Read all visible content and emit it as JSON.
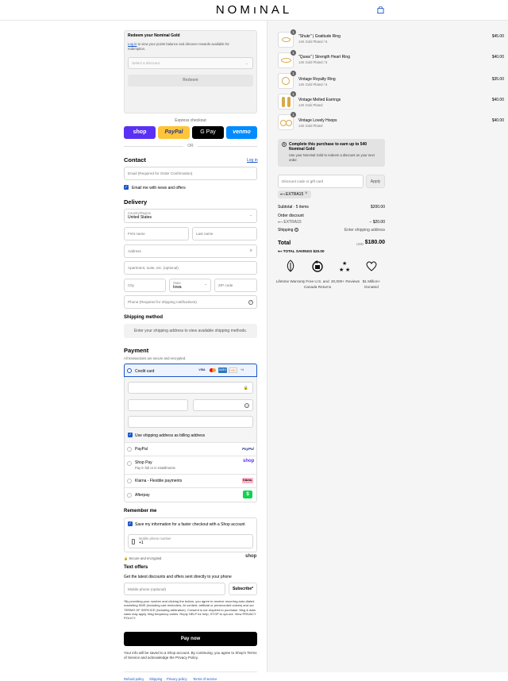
{
  "header": {
    "logo": "NOMıNAL"
  },
  "redeem": {
    "title": "Redeem your Nominal Gold",
    "login_link": "Log in",
    "desc": " to view your points balance and discover rewards available for redemption.",
    "select_placeholder": "Select a discount",
    "button": "Redeem"
  },
  "express": {
    "label": "Express checkout",
    "shop": "shop",
    "paypal": "PayPal",
    "gpay": "G Pay",
    "venmo": "venmo",
    "or": "OR"
  },
  "contact": {
    "title": "Contact",
    "login": "Log in",
    "email_placeholder": "Email (Required for Order Confirmation)",
    "news": "Email me with news and offers"
  },
  "delivery": {
    "title": "Delivery",
    "country_label": "Country/Region",
    "country": "United States",
    "first": "First name",
    "last": "Last name",
    "address": "Address",
    "apt": "Apartment, suite, etc. (optional)",
    "city": "City",
    "state_label": "State",
    "state": "Iowa",
    "zip": "ZIP code",
    "phone": "Phone (Required for shipping notifications)"
  },
  "shipping": {
    "title": "Shipping method",
    "note": "Enter your shipping address to view available shipping methods."
  },
  "payment": {
    "title": "Payment",
    "sub": "All transactions are secure and encrypted.",
    "credit": "Credit card",
    "cards": [
      "VISA",
      "MC",
      "AMEX",
      "DISC",
      "+4"
    ],
    "billing": "Use shipping address as billing address",
    "paypal": "PayPal",
    "paypal_logo": "PayPal",
    "shoppay": "Shop Pay",
    "shoppay_sub": "Pay in full or in installments",
    "shoppay_logo": "shop",
    "klarna": "Klarna - Flexible payments",
    "klarna_logo": "Klarna.",
    "afterpay": "Afterpay",
    "afterpay_logo": "$"
  },
  "remember": {
    "title": "Remember me",
    "save": "Save my information for a faster checkout with a Shop account",
    "mobile_label": "Mobile phone number",
    "mobile_prefix": "+1",
    "secure": "Secure and encrypted",
    "shop_logo": "shop"
  },
  "text_offers": {
    "title": "Text offers",
    "sub": "Get the latest discounts and offers sent directly to your phone",
    "phone_placeholder": "Mobile phone (optional)",
    "subscribe": "Subscribe*",
    "legal": "*By providing your number and clicking the button, you agree to receive recurring auto-dialed marketing SMS (including cart reminders, AI content, artificial or prerecorded voices) and our TERMS OF SERVICE (including arbitration). Consent is not required to purchase. Msg & data rates may apply. Msg frequency varies. Reply HELP for help, STOP to opt-out. View PRIVACY POLICY."
  },
  "pay_button": "Pay now",
  "footer_note": "Your info will be saved to a Shop account. By continuing, you agree to Shop's Terms of Service and acknowledge the Privacy Policy.",
  "footer_links": [
    "Refund policy",
    "Shipping",
    "Privacy policy",
    "Terms of service"
  ],
  "items": [
    {
      "name": "\"Shukr\" | Gratitude Ring",
      "variant": "14K Gold Plated / 5",
      "price": "$45.00",
      "qty": "1"
    },
    {
      "name": "\"Quwa\" | Strength Heart Ring",
      "variant": "14K Gold Plated / 5",
      "price": "$40.00",
      "qty": "1"
    },
    {
      "name": "Vintage Royalty Ring",
      "variant": "14K Gold Plated / 5",
      "price": "$35.00",
      "qty": "1"
    },
    {
      "name": "Vintage Melted Earrings",
      "variant": "14K Gold Plated",
      "price": "$40.00",
      "qty": "1"
    },
    {
      "name": "Vintage Lovely Hoops",
      "variant": "14K Gold Plated",
      "price": "$40.00",
      "qty": "1"
    }
  ],
  "gold_banner": {
    "title": "Complete this purchase to earn up to 540 Nominal Gold",
    "sub": "Use your Nominal Gold to redeem a discount on your next order."
  },
  "discount": {
    "placeholder": "Discount code or gift card",
    "apply": "Apply",
    "tag": "EXTRA15"
  },
  "summary": {
    "subtotal_label": "Subtotal · 5 items",
    "subtotal": "$200.00",
    "order_discount": "Order discount",
    "code": "EXTRA15",
    "discount": "− $20.00",
    "shipping_label": "Shipping",
    "shipping": "Enter shipping address",
    "total_label": "Total",
    "currency": "USD",
    "total": "$180.00",
    "savings": "TOTAL SAVINGS  $20.00"
  },
  "features": [
    {
      "icon": "leaf-icon",
      "label": "Lifetime Warranty"
    },
    {
      "icon": "truck-icon",
      "label": "Free U.S. and Canada Returns"
    },
    {
      "icon": "stars-icon",
      "label": "20,000+ Reviews"
    },
    {
      "icon": "heart-icon",
      "label": "$1 Million+ Donated"
    }
  ],
  "colors": {
    "accent": "#1b57c9",
    "shop": "#5a31f4",
    "paypal": "#ffc439",
    "venmo": "#008cff",
    "gold": "#d8a94a"
  }
}
